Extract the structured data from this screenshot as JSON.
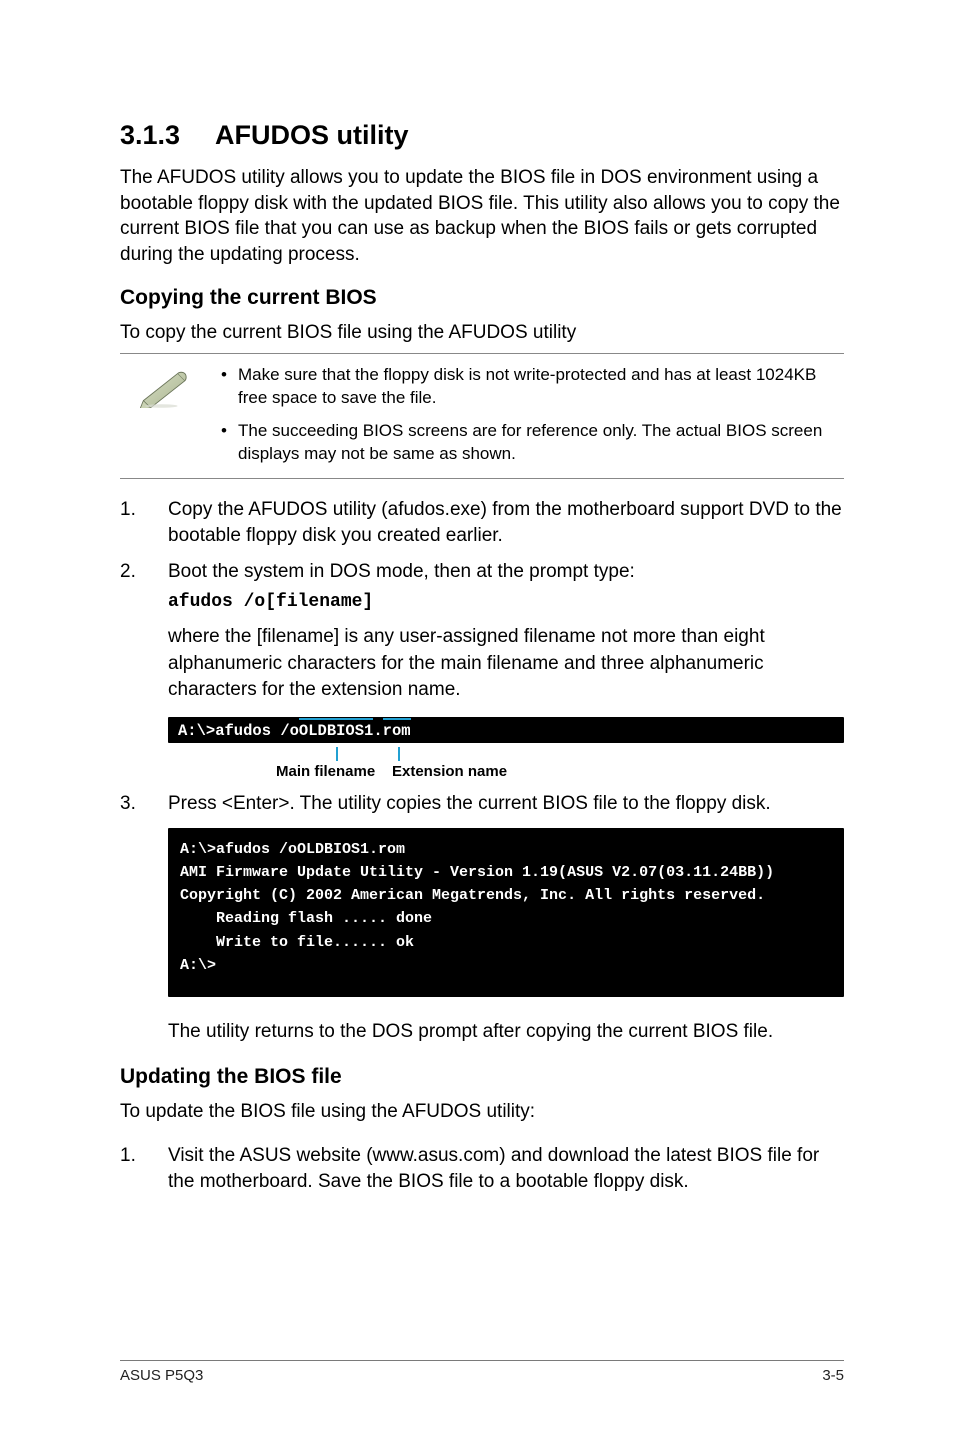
{
  "section": {
    "number": "3.1.3",
    "title": "AFUDOS utility"
  },
  "intro": "The AFUDOS utility allows you to update the BIOS file in DOS environment using a bootable floppy disk with the updated BIOS file. This utility also allows you to copy the current BIOS file that you can use as backup when the BIOS fails or gets corrupted during the updating process.",
  "copy": {
    "heading": "Copying the current BIOS",
    "lead": "To copy the current BIOS file using the AFUDOS utility",
    "notes": [
      "Make sure that the floppy disk is not write-protected and has at least 1024KB free space to save the file.",
      "The succeeding BIOS screens are for reference only. The actual BIOS screen displays may not be same as shown."
    ],
    "steps": [
      {
        "n": "1.",
        "text": "Copy the AFUDOS utility (afudos.exe) from the motherboard support DVD to the bootable floppy disk you created earlier."
      },
      {
        "n": "2.",
        "text": "Boot the system in DOS mode, then at the prompt type:",
        "cmd": "afudos /o[filename]"
      }
    ],
    "filename_note": "where the [filename] is any user-assigned filename not more than eight alphanumeric characters  for the main filename and three alphanumeric characters for the extension name."
  },
  "term1": {
    "prefix": "A:\\>afudos /o",
    "main": "OLDBIOS1",
    "dot": ".",
    "ext": "rom",
    "label_main": "Main filename",
    "label_ext": "Extension name"
  },
  "step3": {
    "n": "3.",
    "text": "Press <Enter>. The utility copies the current BIOS file to the floppy disk."
  },
  "term2_lines": "A:\\>afudos /oOLDBIOS1.rom\nAMI Firmware Update Utility - Version 1.19(ASUS V2.07(03.11.24BB))\nCopyright (C) 2002 American Megatrends, Inc. All rights reserved.\n    Reading flash ..... done\n    Write to file...... ok\nA:\\>",
  "after_term2": "The utility returns to the DOS prompt after copying the current BIOS file.",
  "update": {
    "heading": "Updating the BIOS file",
    "lead": "To update the BIOS file using the AFUDOS utility:",
    "steps": [
      {
        "n": "1.",
        "text": "Visit the ASUS website (www.asus.com) and download the latest BIOS file for the motherboard. Save the BIOS file to a bootable floppy disk."
      }
    ]
  },
  "footer": {
    "left": "ASUS P5Q3",
    "right": "3-5"
  }
}
